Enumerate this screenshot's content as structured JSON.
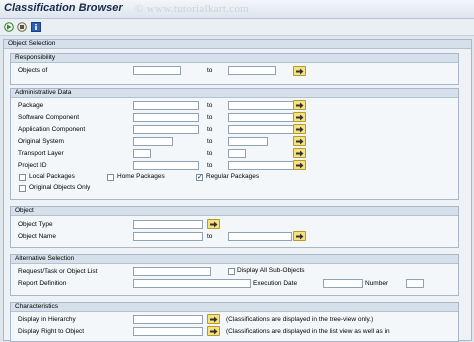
{
  "window": {
    "title": "Classification Browser",
    "watermark": "© www.tutorialkart.com"
  },
  "toolbar": {
    "icons": [
      "execute-icon",
      "variant-icon",
      "info-icon"
    ]
  },
  "object_selection": {
    "title": "Object Selection",
    "responsibility": {
      "title": "Responsibility",
      "objects_of": "Objects of",
      "to": "to"
    },
    "admin": {
      "title": "Administrative Data",
      "package": "Package",
      "software_component": "Software Component",
      "application_component": "Application Component",
      "original_system": "Original System",
      "transport_layer": "Transport Layer",
      "project_id": "Project ID",
      "to": "to",
      "local_packages": "Local Packages",
      "home_packages": "Home Packages",
      "regular_packages": "Regular Packages",
      "original_objects_only": "Original Objects Only",
      "checked": {
        "local_packages": false,
        "home_packages": false,
        "regular_packages": true,
        "original_objects_only": false
      }
    },
    "object": {
      "title": "Object",
      "object_type": "Object Type",
      "object_name": "Object Name",
      "to": "to"
    },
    "alternative": {
      "title": "Alternative Selection",
      "request_task": "Request/Task or Object List",
      "display_all_subobjects": "Display All Sub-Objects",
      "report_definition": "Report Definition",
      "execution_date": "Execution Date",
      "number": "Number"
    },
    "characteristics": {
      "title": "Characteristics",
      "display_in_hierarchy": "Display in Hierarchy",
      "display_right_to_object": "Display Right to Object",
      "hierarchy_note": "(Classifications are displayed in the tree-view only.)",
      "right_note": "(Classifications are displayed in the list view as well as in"
    }
  }
}
